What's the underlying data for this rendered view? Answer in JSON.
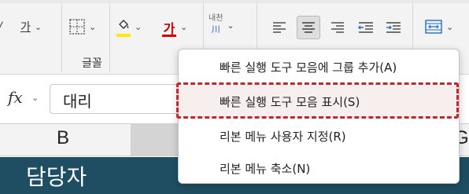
{
  "ribbon": {
    "group_label": "글꼴",
    "underline_letter": "가",
    "font_color_letter": "가",
    "phonetic_top": "내천",
    "phonetic_bottom": "川",
    "colors": {
      "font_color": "#e00000",
      "fill_color": "#ffea00"
    }
  },
  "formula_bar": {
    "fx_label": "fx",
    "value": "대리"
  },
  "columns": {
    "left": "B",
    "right": "G"
  },
  "cell": {
    "text": "담당자"
  },
  "context_menu": {
    "items": [
      {
        "label": "빠른 실행 도구 모음에 그룹 추가(A)"
      },
      {
        "label": "빠른 실행 도구 모음 표시(S)"
      },
      {
        "label": "리본 메뉴 사용자 지정(R)"
      },
      {
        "label": "리본 메뉴 축소(N)"
      }
    ],
    "highlight_color": "#d0222a"
  }
}
